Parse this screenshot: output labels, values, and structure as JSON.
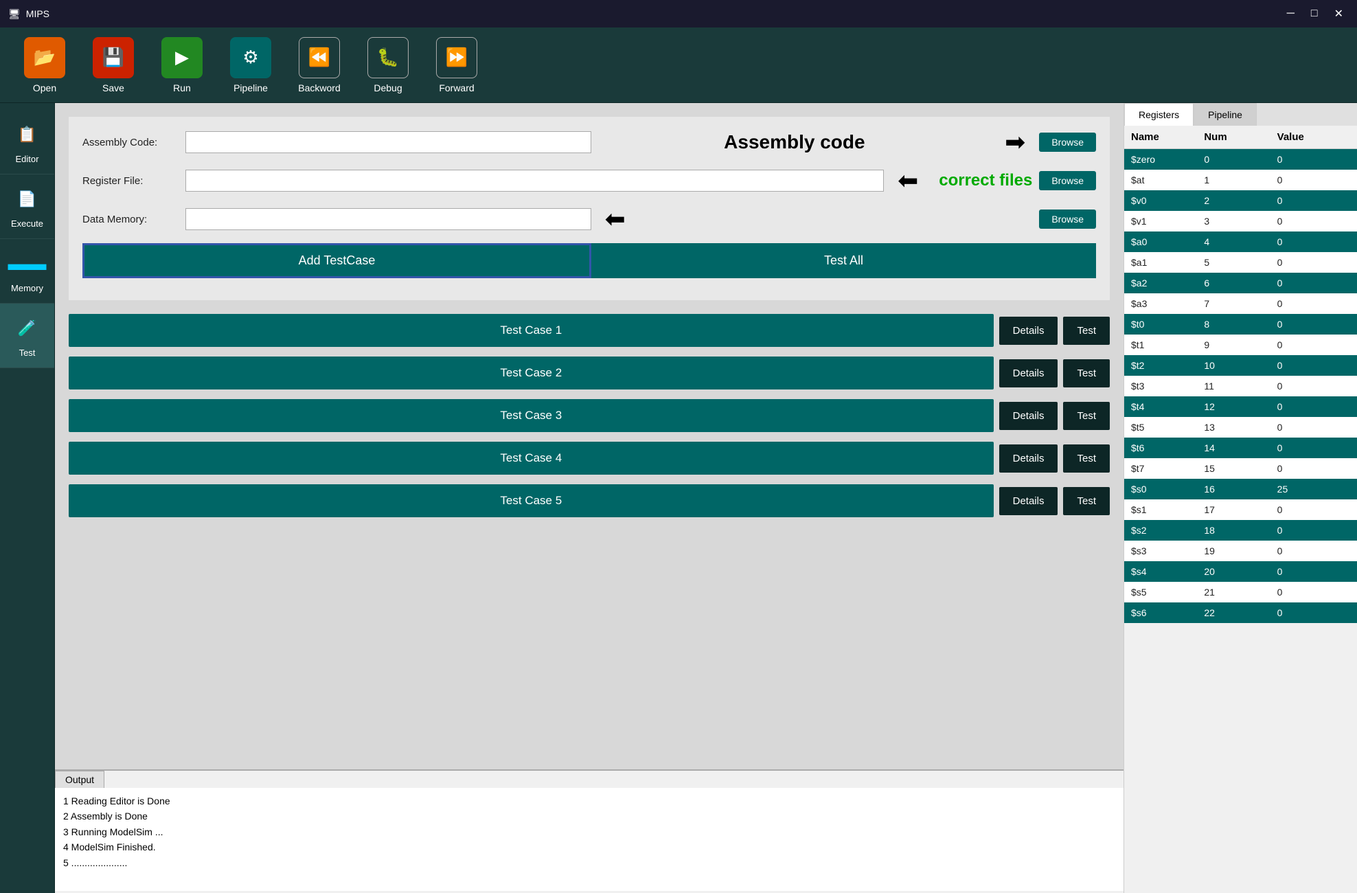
{
  "titlebar": {
    "title": "MIPS",
    "controls": [
      "─",
      "□",
      "✕"
    ]
  },
  "toolbar": {
    "buttons": [
      {
        "id": "open",
        "label": "Open",
        "icon": "📂",
        "color": "orange"
      },
      {
        "id": "save",
        "label": "Save",
        "icon": "💾",
        "color": "red"
      },
      {
        "id": "run",
        "label": "Run",
        "icon": "▶",
        "color": "green"
      },
      {
        "id": "pipeline",
        "label": "Pipeline",
        "icon": "⚙",
        "color": "teal"
      },
      {
        "id": "backward",
        "label": "Backword",
        "icon": "⏪",
        "color": "dark"
      },
      {
        "id": "debug",
        "label": "Debug",
        "icon": "🐛",
        "color": "dark"
      },
      {
        "id": "forward",
        "label": "Forward",
        "icon": "⏩",
        "color": "dark"
      }
    ]
  },
  "sidebar": {
    "items": [
      {
        "id": "editor",
        "label": "Editor",
        "icon": "📋"
      },
      {
        "id": "execute",
        "label": "Execute",
        "icon": "📄"
      },
      {
        "id": "memory",
        "label": "Memory",
        "icon": "🔲"
      },
      {
        "id": "test",
        "label": "Test",
        "icon": "🧪"
      }
    ]
  },
  "form": {
    "assembly_code_label": "Assembly Code:",
    "assembly_title": "Assembly code",
    "register_file_label": "Register File:",
    "data_memory_label": "Data Memory:",
    "browse_label": "Browse",
    "correct_files_text": "correct files",
    "add_testcase_label": "Add TestCase",
    "test_all_label": "Test All"
  },
  "test_cases": [
    {
      "id": 1,
      "label": "Test Case 1",
      "details": "Details",
      "test": "Test"
    },
    {
      "id": 2,
      "label": "Test Case 2",
      "details": "Details",
      "test": "Test"
    },
    {
      "id": 3,
      "label": "Test Case 3",
      "details": "Details",
      "test": "Test"
    },
    {
      "id": 4,
      "label": "Test Case 4",
      "details": "Details",
      "test": "Test"
    },
    {
      "id": 5,
      "label": "Test Case 5",
      "details": "Details",
      "test": "Test"
    }
  ],
  "output": {
    "tab_label": "Output",
    "lines": [
      "1 Reading Editor is Done",
      "2 Assembly is Done",
      "3 Running ModelSim ...",
      "4 ModelSim Finished.",
      "5 ....................."
    ]
  },
  "registers": {
    "tabs": [
      "Registers",
      "Pipeline"
    ],
    "active_tab": "Registers",
    "columns": [
      "Name",
      "Num",
      "Value"
    ],
    "rows": [
      {
        "name": "$zero",
        "num": "0",
        "value": "0",
        "alt": true
      },
      {
        "name": "$at",
        "num": "1",
        "value": "0",
        "alt": false
      },
      {
        "name": "$v0",
        "num": "2",
        "value": "0",
        "alt": true
      },
      {
        "name": "$v1",
        "num": "3",
        "value": "0",
        "alt": false
      },
      {
        "name": "$a0",
        "num": "4",
        "value": "0",
        "alt": true
      },
      {
        "name": "$a1",
        "num": "5",
        "value": "0",
        "alt": false
      },
      {
        "name": "$a2",
        "num": "6",
        "value": "0",
        "alt": true
      },
      {
        "name": "$a3",
        "num": "7",
        "value": "0",
        "alt": false
      },
      {
        "name": "$t0",
        "num": "8",
        "value": "0",
        "alt": true
      },
      {
        "name": "$t1",
        "num": "9",
        "value": "0",
        "alt": false
      },
      {
        "name": "$t2",
        "num": "10",
        "value": "0",
        "alt": true
      },
      {
        "name": "$t3",
        "num": "11",
        "value": "0",
        "alt": false
      },
      {
        "name": "$t4",
        "num": "12",
        "value": "0",
        "alt": true
      },
      {
        "name": "$t5",
        "num": "13",
        "value": "0",
        "alt": false
      },
      {
        "name": "$t6",
        "num": "14",
        "value": "0",
        "alt": true
      },
      {
        "name": "$t7",
        "num": "15",
        "value": "0",
        "alt": false
      },
      {
        "name": "$s0",
        "num": "16",
        "value": "25",
        "alt": true
      },
      {
        "name": "$s1",
        "num": "17",
        "value": "0",
        "alt": false
      },
      {
        "name": "$s2",
        "num": "18",
        "value": "0",
        "alt": true
      },
      {
        "name": "$s3",
        "num": "19",
        "value": "0",
        "alt": false
      },
      {
        "name": "$s4",
        "num": "20",
        "value": "0",
        "alt": true
      },
      {
        "name": "$s5",
        "num": "21",
        "value": "0",
        "alt": false
      },
      {
        "name": "$s6",
        "num": "22",
        "value": "0",
        "alt": true
      }
    ]
  }
}
